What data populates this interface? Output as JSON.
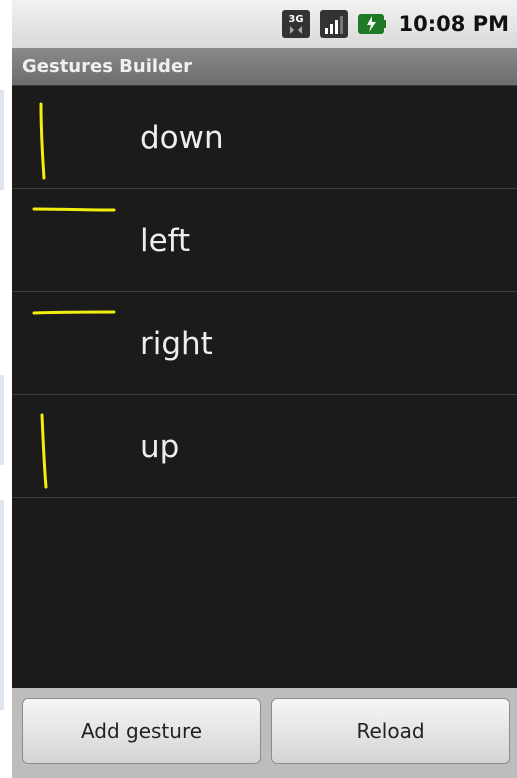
{
  "status_bar": {
    "network_icon": "3g-icon",
    "signal_icon": "signal-bars-icon",
    "battery_icon": "battery-charging-icon",
    "time": "10:08 PM"
  },
  "app": {
    "title": "Gestures Builder"
  },
  "gestures": [
    {
      "name": "down",
      "icon": "vertical-stroke-gesture"
    },
    {
      "name": "left",
      "icon": "horizontal-stroke-gesture"
    },
    {
      "name": "right",
      "icon": "horizontal-stroke-gesture"
    },
    {
      "name": "up",
      "icon": "vertical-stroke-gesture"
    }
  ],
  "buttons": {
    "add": "Add gesture",
    "reload": "Reload"
  },
  "colors": {
    "gesture_stroke": "#f2ee10",
    "list_background": "#1b1b1b",
    "title_bar": "#7b7b7b",
    "status_bar": "#e6e6e6"
  }
}
